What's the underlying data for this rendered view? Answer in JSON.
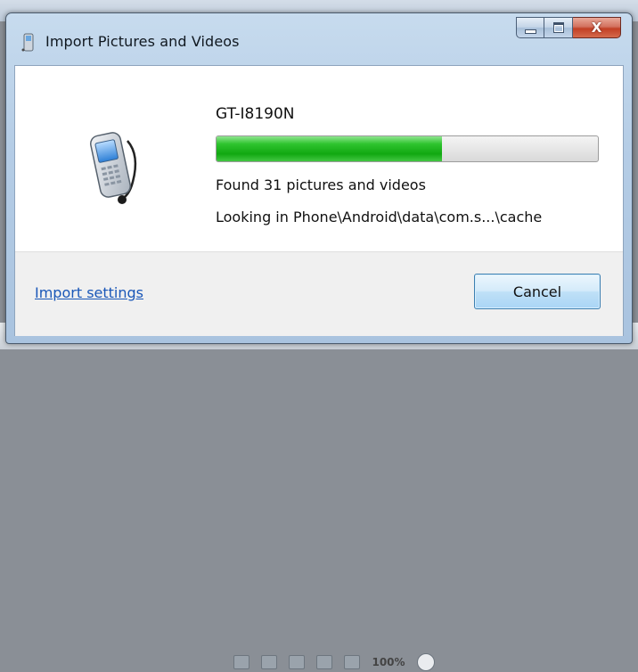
{
  "window": {
    "title": "Import Pictures and Videos",
    "caption_buttons": {
      "minimize_icon": "minimize-icon",
      "maximize_icon": "maximize-icon",
      "close_icon": "close-icon",
      "close_glyph": "X"
    }
  },
  "device": {
    "name": "GT-I8190N",
    "icon": "phone-icon"
  },
  "progress": {
    "fraction": 0.59,
    "color": "#1aad1a"
  },
  "status": {
    "found": "Found 31 pictures and videos",
    "looking": "Looking in  Phone\\Android\\data\\com.s...\\cache"
  },
  "footer": {
    "import_settings_link": "Import settings",
    "cancel_button": "Cancel"
  },
  "background": {
    "zoom_text": "100%"
  }
}
